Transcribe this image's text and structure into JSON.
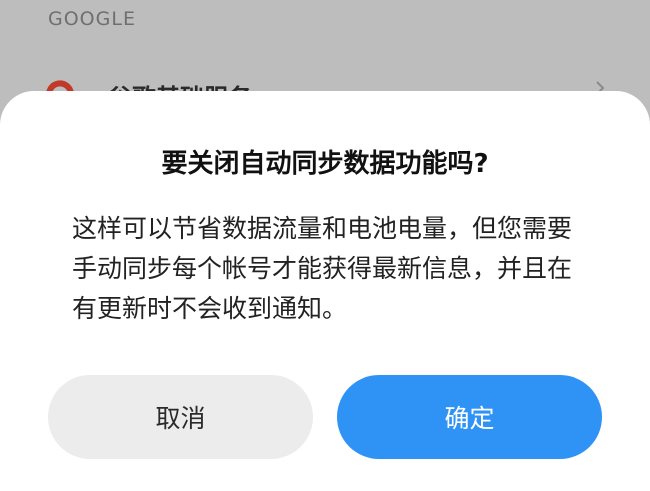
{
  "background": {
    "section_header": "GOOGLE",
    "row": {
      "icon": "google-g-icon",
      "label": "谷歌基础服务",
      "chevron": "chevron-right-icon"
    }
  },
  "dialog": {
    "title": "要关闭自动同步数据功能吗?",
    "message": "这样可以节省数据流量和电池电量，但您需要手动同步每个帐号才能获得最新信息，并且在有更新时不会收到通知。",
    "cancel_label": "取消",
    "confirm_label": "确定"
  },
  "colors": {
    "overlay": "#bdbdbd",
    "dialog_bg": "#ffffff",
    "cancel_bg": "#ececec",
    "confirm_bg": "#2f93f5",
    "google_red": "#ea4335"
  }
}
